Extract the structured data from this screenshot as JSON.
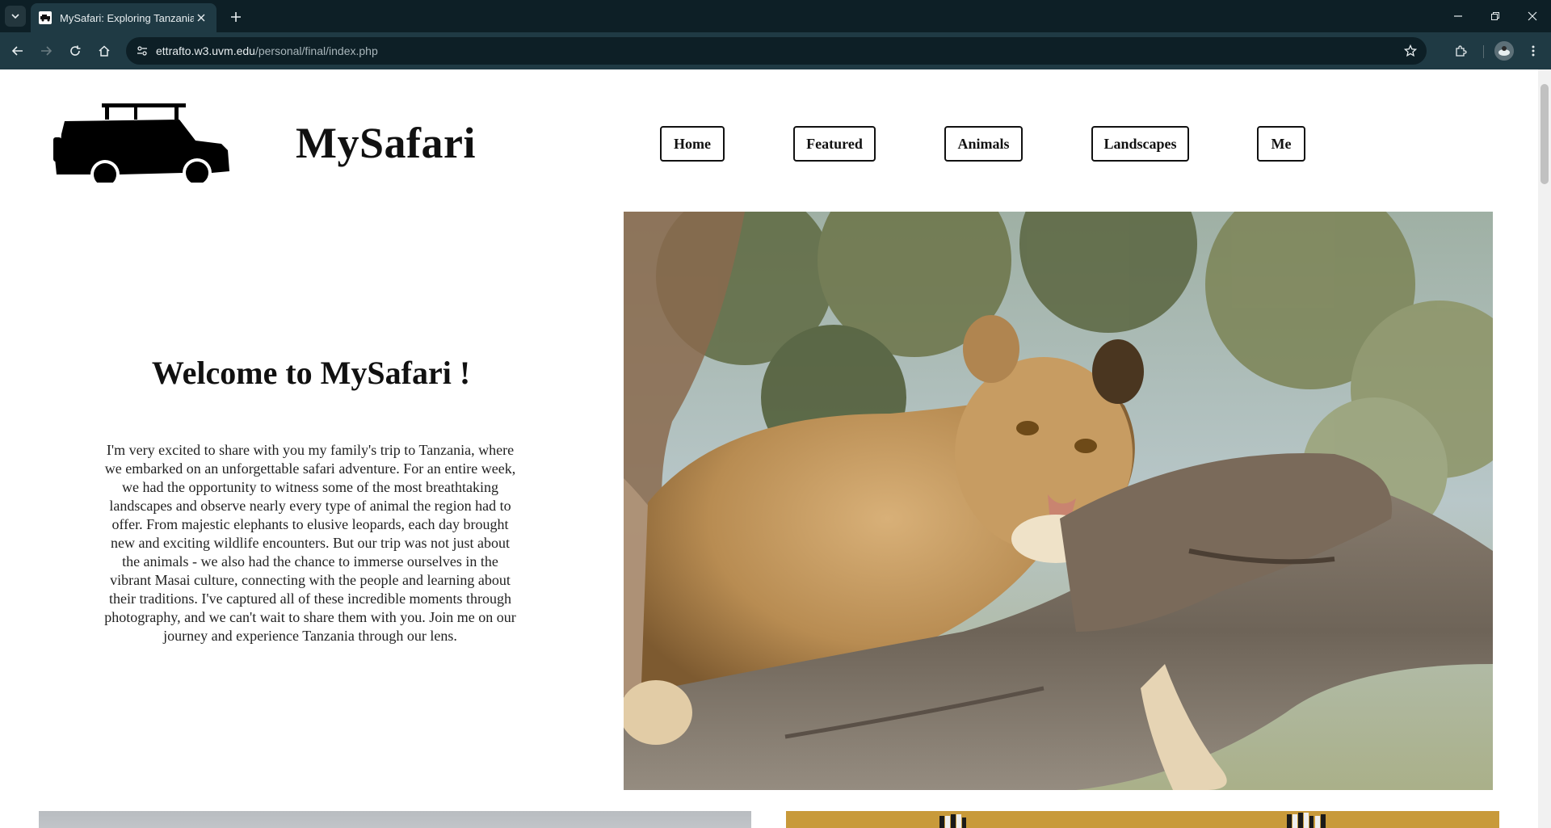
{
  "browser": {
    "tab_title": "MySafari: Exploring Tanzania",
    "url_host": "ettrafto.w3.uvm.edu",
    "url_path": "/personal/final/index.php"
  },
  "site": {
    "title": "MySafari",
    "nav": [
      {
        "label": "Home"
      },
      {
        "label": "Featured"
      },
      {
        "label": "Animals"
      },
      {
        "label": "Landscapes"
      },
      {
        "label": "Me"
      }
    ]
  },
  "main": {
    "heading": "Welcome to MySafari !",
    "intro": "I'm very excited to share with you my family's trip to Tanzania, where we embarked on an unforgettable safari adventure. For an entire week, we had the opportunity to witness some of the most breathtaking landscapes and observe nearly every type of animal the region had to offer. From majestic elephants to elusive leopards, each day brought new and exciting wildlife encounters. But our trip was not just about the animals - we also had the chance to immerse ourselves in the vibrant Masai culture, connecting with the people and learning about their traditions. I've captured all of these incredible moments through photography, and we can't wait to share them with you. Join me on our journey and experience Tanzania through our lens."
  }
}
